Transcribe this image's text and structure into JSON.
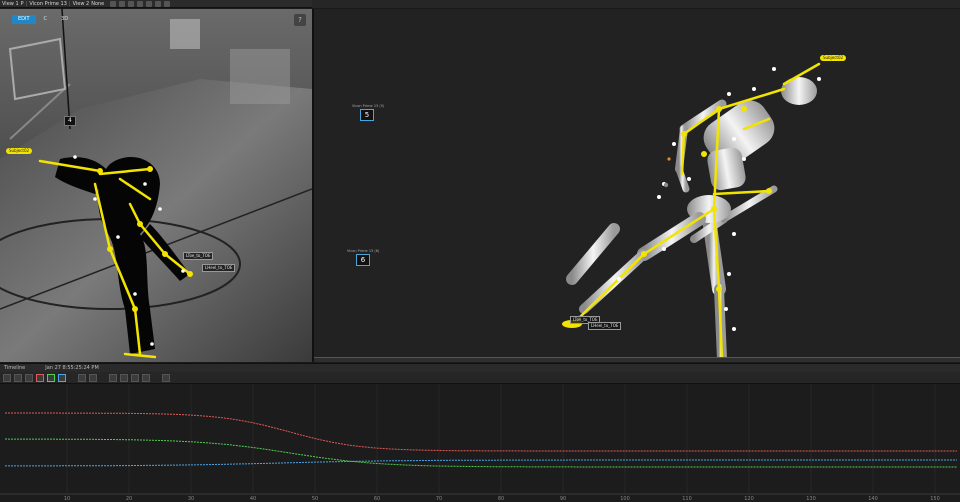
{
  "toolbar": {
    "view1_label": "View 1",
    "view1_mode": "P",
    "camera_label": "Vicon Prime 13",
    "view2_label": "View 2",
    "view2_value": "None"
  },
  "left_view": {
    "mode_buttons": [
      "EDIT",
      "C",
      "3D"
    ],
    "help_label": "?",
    "cam_number": "4",
    "subject_tag": "Subject02",
    "marker_label_1": "LToe_to_TOE",
    "marker_label_2": "LHeel_to_TOE"
  },
  "right_view": {
    "subject_tag": "Subject02",
    "camera_5": {
      "number": "5",
      "caption": "Vicon Prime 13 (5)"
    },
    "camera_6": {
      "number": "6",
      "caption": "Vicon Prime 13 (6)"
    },
    "marker_label_1": "LToe_to_TOE",
    "marker_label_2": "LHeel_to_TOE"
  },
  "graph": {
    "header_left": "Timeline",
    "header_right": "Jan 27 8:55:25:24 PM",
    "x_ticks": [
      "10",
      "20",
      "30",
      "40",
      "50",
      "60",
      "70",
      "80",
      "90",
      "100",
      "110",
      "120",
      "130",
      "140",
      "150"
    ],
    "colors": {
      "red": "#e05a5a",
      "green": "#4fd04f",
      "blue": "#4aa6e6"
    }
  }
}
